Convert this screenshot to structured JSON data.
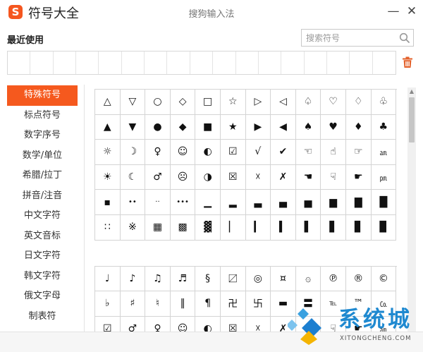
{
  "window": {
    "logo_letter": "S",
    "app_title": "符号大全",
    "center_title": "搜狗输入法",
    "minimize_glyph": "—",
    "close_glyph": "✕"
  },
  "recent": {
    "label": "最近使用",
    "slot_count": 17
  },
  "search": {
    "placeholder": "搜索符号",
    "value": ""
  },
  "sidebar": {
    "items": [
      {
        "label": "特殊符号",
        "active": true
      },
      {
        "label": "标点符号",
        "active": false
      },
      {
        "label": "数字序号",
        "active": false
      },
      {
        "label": "数学/单位",
        "active": false
      },
      {
        "label": "希腊/拉丁",
        "active": false
      },
      {
        "label": "拼音/注音",
        "active": false
      },
      {
        "label": "中文字符",
        "active": false
      },
      {
        "label": "英文音标",
        "active": false
      },
      {
        "label": "日文字符",
        "active": false
      },
      {
        "label": "韩文字符",
        "active": false
      },
      {
        "label": "俄文字母",
        "active": false
      },
      {
        "label": "制表符",
        "active": false
      }
    ]
  },
  "symbols_group_1": [
    "△",
    "▽",
    "○",
    "◇",
    "□",
    "☆",
    "▷",
    "◁",
    "♤",
    "♡",
    "♢",
    "♧",
    "▲",
    "▼",
    "●",
    "◆",
    "■",
    "★",
    "▶",
    "◀",
    "♠",
    "♥",
    "♦",
    "♣",
    "☼",
    "☽",
    "♀",
    "☺",
    "◐",
    "☑",
    "√",
    "✔",
    "☜",
    "☝",
    "☞",
    "㏂",
    "☀",
    "☾",
    "♂",
    "☹",
    "◑",
    "☒",
    "☓",
    "✗",
    "☚",
    "☟",
    "☛",
    "㏘",
    "▪",
    "••",
    "··",
    "•••",
    "▁",
    "▂",
    "▃",
    "▄",
    "▅",
    "▆",
    "▇",
    "█",
    "∷",
    "※",
    "▦",
    "▩",
    "▓",
    "▏",
    "▎",
    "▍",
    "▌",
    "▋",
    "▊",
    "▉"
  ],
  "symbols_group_2": [
    "♩",
    "♪",
    "♫",
    "♬",
    "§",
    "〼",
    "◎",
    "¤",
    "۞",
    "℗",
    "®",
    "©",
    "♭",
    "♯",
    "♮",
    "‖",
    "¶",
    "卍",
    "卐",
    "▬",
    "〓",
    "℡",
    "™",
    "㏇",
    "☑",
    "♂",
    "♀",
    "☺",
    "◐",
    "☒",
    "☓",
    "✗",
    "☚",
    "☟",
    "☛",
    "㏂"
  ],
  "watermark": {
    "text": "系统城",
    "sub": "XITONGCHENG.COM"
  },
  "colors": {
    "accent": "#f5591e",
    "watermark_blue": "#1f89d0"
  }
}
